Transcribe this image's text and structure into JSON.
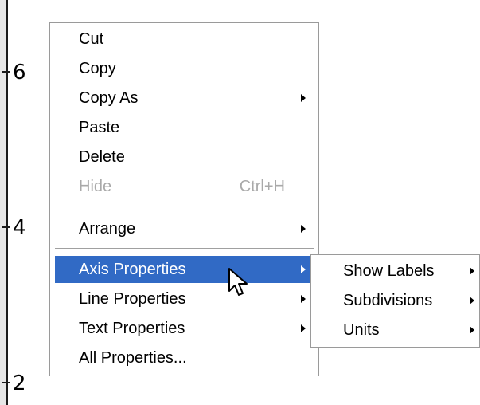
{
  "axis": {
    "tick_labels": [
      "6",
      "4",
      "2"
    ]
  },
  "context_menu": {
    "items": [
      {
        "label": "Cut"
      },
      {
        "label": "Copy"
      },
      {
        "label": "Copy As",
        "has_submenu": true
      },
      {
        "label": "Paste"
      },
      {
        "label": "Delete"
      },
      {
        "label": "Hide",
        "shortcut": "Ctrl+H",
        "disabled": true
      },
      {
        "label": "Arrange",
        "has_submenu": true
      },
      {
        "label": "Axis Properties",
        "has_submenu": true,
        "highlighted": true
      },
      {
        "label": "Line Properties",
        "has_submenu": true
      },
      {
        "label": "Text Properties",
        "has_submenu": true
      },
      {
        "label": "All Properties..."
      }
    ]
  },
  "axis_properties_submenu": {
    "items": [
      {
        "label": "Show Labels",
        "has_submenu": true
      },
      {
        "label": "Subdivisions",
        "has_submenu": true
      },
      {
        "label": "Units",
        "has_submenu": true
      }
    ]
  },
  "colors": {
    "highlight": "#316ac5",
    "disabled_text": "#a9a9a9",
    "menu_border": "#9a9a9a"
  },
  "icons": {
    "cursor": "arrow-pointer-icon",
    "submenu": "submenu-arrow-icon"
  }
}
